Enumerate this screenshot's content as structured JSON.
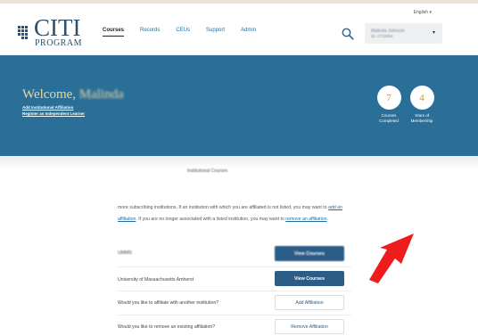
{
  "header": {
    "language": "English ▾",
    "logo_citi": "CITI",
    "logo_program": "PROGRAM",
    "nav": [
      {
        "label": "Courses",
        "active": true
      },
      {
        "label": "Records",
        "active": false
      },
      {
        "label": "CEUs",
        "active": false
      },
      {
        "label": "Support",
        "active": false
      },
      {
        "label": "Admin",
        "active": false
      }
    ],
    "user": {
      "name": "Malinda Johnson",
      "id": "ID: 2715604",
      "caret": "▾"
    }
  },
  "banner": {
    "welcome_prefix": "Welcome, ",
    "welcome_name": "Malinda",
    "link_add_affiliation": "Add Institutional Affiliation",
    "link_register_independent": "Register as Independent Learner",
    "stats": [
      {
        "value": "7",
        "label_line1": "Courses",
        "label_line2": "Completed"
      },
      {
        "value": "4",
        "label_line1": "Years of",
        "label_line2": "Membership"
      }
    ],
    "colors": {
      "banner": "#2a6f97",
      "welcome": "#e8d7a6",
      "stat_number": "#c9962c"
    }
  },
  "main": {
    "section_title": "Institutional Courses",
    "para_text_1": "more subscribing institutions. If an institution with which you are affiliated is not listed, you may want to ",
    "para_link_add": "add an affiliation",
    "para_text_2": ". If you are no longer associated with a listed institution, you may want to ",
    "para_link_remove": "remove an affiliation",
    "para_text_3": ".",
    "rows": [
      {
        "label": "UMMS",
        "button": "View Courses",
        "blurred": true
      },
      {
        "label": "University of Massachusetts Amherst",
        "button": "View Courses",
        "blurred": false
      }
    ],
    "affiliate_question": "Would you like to affiliate with another institution?",
    "affiliate_button": "Add Affiliation",
    "remove_question": "Would you like to remove an existing affiliation?",
    "remove_button": "Remove Affiliation"
  },
  "annotation": {
    "arrow_color": "#ee1c1c"
  }
}
